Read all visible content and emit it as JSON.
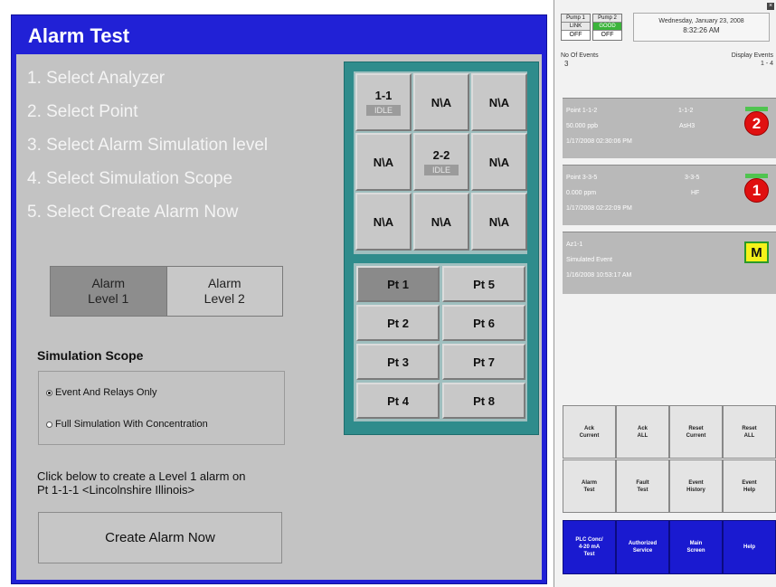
{
  "title": "Alarm Test",
  "steps": [
    "1. Select Analyzer",
    "2. Select Point",
    "3. Select Alarm Simulation level",
    "4. Select Simulation Scope",
    "5. Select Create Alarm Now"
  ],
  "alarm_levels": [
    {
      "label": "Alarm\nLevel 1",
      "selected": true
    },
    {
      "label": "Alarm\nLevel 2",
      "selected": false
    }
  ],
  "simulation_scope": {
    "title": "Simulation Scope",
    "options": [
      {
        "label": "Event And Relays Only",
        "selected": true
      },
      {
        "label": "Full Simulation With Concentration",
        "selected": false
      }
    ]
  },
  "create_prompt": {
    "line1": "Click below to create a Level  1 alarm on",
    "line2": "Pt 1-1-1 <Lincolnshire Illinois>"
  },
  "create_button": "Create Alarm Now",
  "analyzers": [
    {
      "label": "1-1",
      "status": "IDLE"
    },
    {
      "label": "N\\A",
      "status": ""
    },
    {
      "label": "N\\A",
      "status": ""
    },
    {
      "label": "N\\A",
      "status": ""
    },
    {
      "label": "2-2",
      "status": "IDLE"
    },
    {
      "label": "N\\A",
      "status": ""
    },
    {
      "label": "N\\A",
      "status": ""
    },
    {
      "label": "N\\A",
      "status": ""
    },
    {
      "label": "N\\A",
      "status": ""
    }
  ],
  "points": [
    "Pt 1",
    "Pt 5",
    "Pt 2",
    "Pt 6",
    "Pt 3",
    "Pt 7",
    "Pt 4",
    "Pt 8"
  ],
  "status_panel": {
    "pump1": {
      "name": "Pump 1",
      "status": "LINK",
      "state": "OFF"
    },
    "pump2": {
      "name": "Pump 2",
      "status": "GOOD",
      "state": "OFF"
    },
    "date": "Wednesday, January 23, 2008",
    "time": "8:32:26 AM",
    "events_label": "No Of Events",
    "events_value": "3",
    "display_label": "Display Events",
    "display_value": "1 - 4"
  },
  "events": [
    {
      "point": "Point 1-1-2",
      "code": "1-1-2",
      "value": "50.000  ppb",
      "gas": "AsH3",
      "datetime": "1/17/2008 02:30:06 PM",
      "level": "2"
    },
    {
      "point": "Point 3-3-5",
      "code": "3-3-5",
      "value": "0.000   ppm",
      "gas": "HF",
      "datetime": "1/17/2008 02:22:09 PM",
      "level": "1"
    },
    {
      "point": "Az1-1",
      "code": "",
      "value": "Simulated Event",
      "gas": "",
      "datetime": "1/16/2008 10:53:17 AM",
      "level": "M"
    }
  ],
  "buttons_row1": [
    "Ack\nCurrent",
    "Ack\nALL",
    "Reset\nCurrent",
    "Reset\nALL"
  ],
  "buttons_row2": [
    "Alarm\nTest",
    "Fault\nTest",
    "Event\nHistory",
    "Event\nHelp"
  ],
  "buttons_row3": [
    "PLC Conc/\n4-20 mA\nTest",
    "Authorized\nService",
    "Main\nScreen",
    "Help"
  ],
  "colors": {
    "title_bar": "#2121d6",
    "panel_bg": "#c3c3c3",
    "frame": "#2f8c8c",
    "alarm_red": "#e01010",
    "maintenance_yellow": "#f5f21a",
    "nav_blue": "#1a1ad0"
  }
}
